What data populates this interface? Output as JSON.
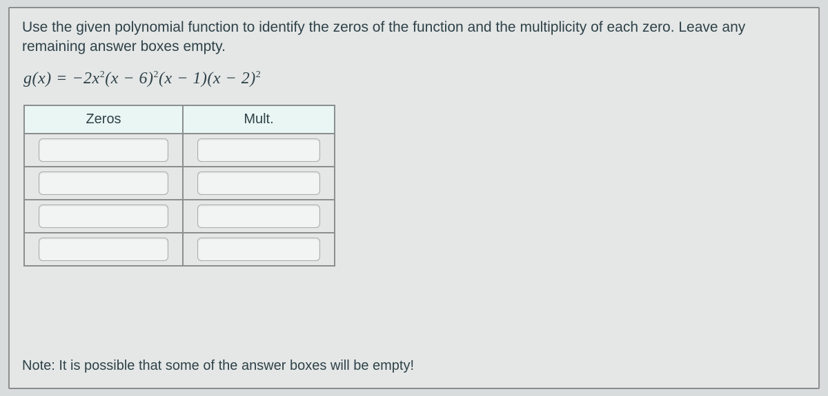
{
  "instructions": "Use the given polynomial function to identify the zeros of the function and the multiplicity of each zero. Leave any remaining answer boxes empty.",
  "equation_plain": "g(x) = −2x²(x − 6)²(x − 1)(x − 2)²",
  "table": {
    "headers": {
      "zeros": "Zeros",
      "mult": "Mult."
    },
    "rows": [
      {
        "zero": "",
        "mult": ""
      },
      {
        "zero": "",
        "mult": ""
      },
      {
        "zero": "",
        "mult": ""
      },
      {
        "zero": "",
        "mult": ""
      }
    ]
  },
  "note": "Note: It is possible that some of the answer boxes will be empty!"
}
